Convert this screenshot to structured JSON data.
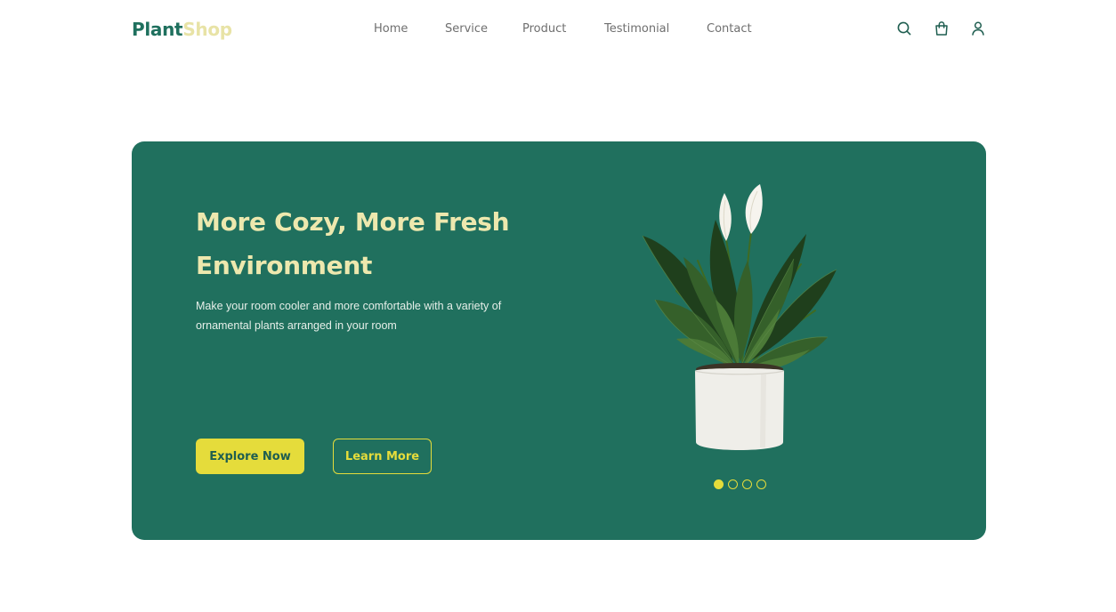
{
  "brand": {
    "part1": "Plant",
    "part2": "Shop"
  },
  "nav": {
    "items": [
      {
        "label": "Home"
      },
      {
        "label": "Service"
      },
      {
        "label": "Product"
      },
      {
        "label": "Testimonial"
      },
      {
        "label": "Contact"
      }
    ]
  },
  "header_icons": [
    "search-icon",
    "shopping-bag-icon",
    "user-icon"
  ],
  "hero": {
    "title": "More Cozy, More Fresh Environment",
    "subtitle": "Make your room cooler and more comfortable with a variety of ornamental plants arranged in your room",
    "primary_button": "Explore Now",
    "secondary_button": "Learn More",
    "image": "potted-peace-lily-plant",
    "slides": {
      "count": 4,
      "active": 1
    }
  },
  "colors": {
    "brand_green": "#20705e",
    "accent_yellow": "#e5dc3b",
    "title_cream": "#ede8ae",
    "logo_light": "#e8e3a6",
    "nav_text": "#6f6f6f",
    "background": "#ffffff"
  }
}
